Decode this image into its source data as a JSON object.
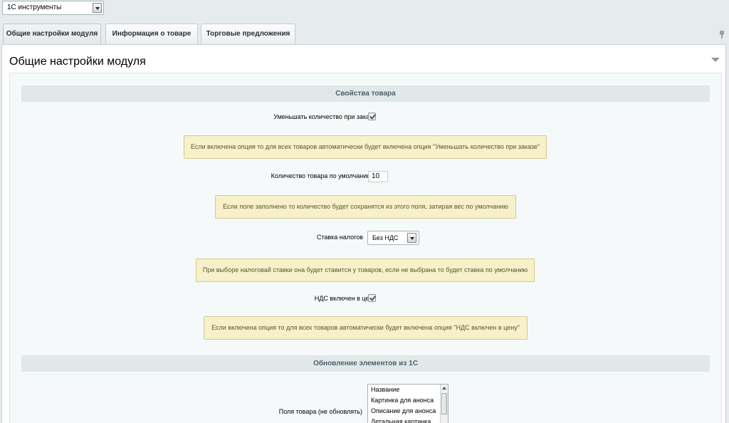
{
  "top_selector": {
    "value": "1С инструменты"
  },
  "tabs": [
    {
      "label": "Общие настройки модуля",
      "active": true
    },
    {
      "label": "Информация о товаре",
      "active": false
    },
    {
      "label": "Торговые предложения",
      "active": false
    }
  ],
  "panel": {
    "title": "Общие настройки модуля"
  },
  "sections": {
    "product_props": {
      "title": "Свойства товара"
    },
    "update_from_1c": {
      "title": "Обновление элементов из 1С"
    }
  },
  "fields": {
    "decrease_qty": {
      "label": "Уменьшать количество при заказе",
      "checked": true,
      "hint": "Если включена опция то для всех товаров автоматически будет включена опция \"Уменьшать количество при заказе\""
    },
    "default_qty": {
      "label": "Количество товара по умолчанию",
      "value": "10",
      "hint": "Если поле заполнено то количество будет сохранятся из этого поля, затирая вес по умолчанию"
    },
    "tax_rate": {
      "label": "Ставка налогов",
      "value": "Без НДС",
      "hint": "При выборе налоговай ставки она будет ставится у товаров, если не выбрана то будет ставка по умолчанию"
    },
    "vat_included": {
      "label": "НДС включен в цену",
      "checked": true,
      "hint": "Если включена опция то для всех товаров автоматически будет включена опция \"НДС включен в цену\""
    },
    "no_update_fields": {
      "label": "Поля товара (не обновлять)",
      "options": [
        "Название",
        "Картинка для анонса",
        "Описание для анонса",
        "Детальная картинка"
      ]
    }
  },
  "colors": {
    "hint_bg": "#f7f1c9",
    "section_bg": "#e0e8ea",
    "page_bg": "#e6ebed"
  }
}
